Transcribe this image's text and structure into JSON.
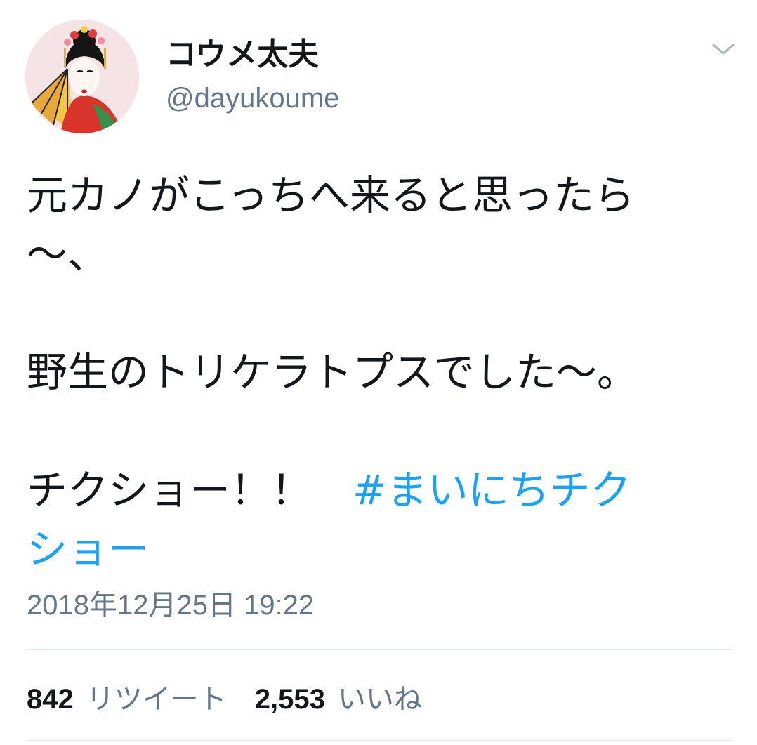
{
  "author": {
    "display_name": "コウメ太夫",
    "handle": "@dayukoume"
  },
  "tweet": {
    "line1": "元カノがこっちへ来ると思ったら",
    "line2": "〜、",
    "line3": "野生のトリケラトプスでした〜。",
    "line4_text": "チクショー！！　",
    "hashtag_part1": "#まいにちチク",
    "hashtag_part2": "ショー"
  },
  "timestamp": "2018年12月25日 19:22",
  "stats": {
    "retweet_count": "842",
    "retweet_label": "リツイート",
    "like_count": "2,553",
    "like_label": "いいね"
  },
  "icons": {
    "more": "chevron-down-icon",
    "avatar": "avatar"
  },
  "colors": {
    "hashtag": "#1da1f2",
    "secondary_text": "#657786",
    "divider": "#e1e8ed"
  }
}
